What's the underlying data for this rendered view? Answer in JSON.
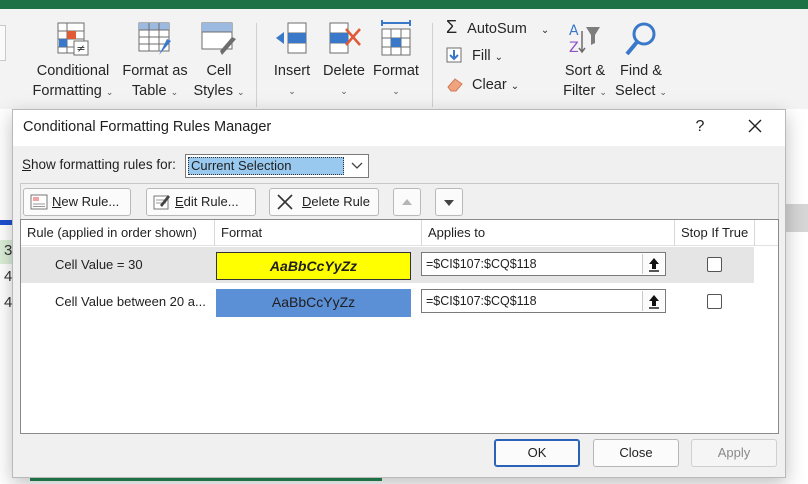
{
  "ribbon": {
    "cells_group": [
      {
        "label1": "Conditional",
        "label2": "Formatting"
      },
      {
        "label1": "Format as",
        "label2": "Table"
      },
      {
        "label1": "Cell",
        "label2": "Styles"
      }
    ],
    "edit_group": [
      {
        "label": "Insert"
      },
      {
        "label": "Delete"
      },
      {
        "label": "Format"
      }
    ],
    "autosum": "AutoSum",
    "fill": "Fill",
    "clear": "Clear",
    "sort_filter": {
      "label1": "Sort &",
      "label2": "Filter"
    },
    "find_select": {
      "label1": "Find &",
      "label2": "Select"
    },
    "caret": "⌄"
  },
  "dialog": {
    "title": "Conditional Formatting Rules Manager",
    "help": "?",
    "show_label_prefix": "S",
    "show_label_rest": "how formatting rules for:",
    "scope_value": "Current Selection",
    "toolbar": {
      "new_rule_u": "N",
      "new_rule_rest": "ew Rule...",
      "edit_rule_u": "E",
      "edit_rule_rest": "dit Rule...",
      "delete_rule_u": "D",
      "delete_rule_rest": "elete Rule"
    },
    "columns": {
      "rule": "Rule (applied in order shown)",
      "format": "Format",
      "applies_to": "Applies to",
      "stop_if_true": "Stop If True"
    },
    "rules": [
      {
        "name": "Cell Value = 30",
        "preview": "AaBbCcYyZz",
        "applies_to": "=$CI$107:$CQ$118",
        "stop_if_true": false,
        "preview_bg": "#ffff00",
        "selected": true
      },
      {
        "name": "Cell Value between 20 a...",
        "preview": "AaBbCcYyZz",
        "applies_to": "=$CI$107:$CQ$118",
        "stop_if_true": false,
        "preview_bg": "#5b8fd6",
        "selected": false
      }
    ],
    "buttons": {
      "ok": "OK",
      "close": "Close",
      "apply": "Apply"
    }
  },
  "background_cells": [
    "3",
    "4",
    "4"
  ],
  "colors": {
    "accent": "#1e7145",
    "selection": "#99c9ef",
    "selected_row": "#e5e5e5"
  }
}
